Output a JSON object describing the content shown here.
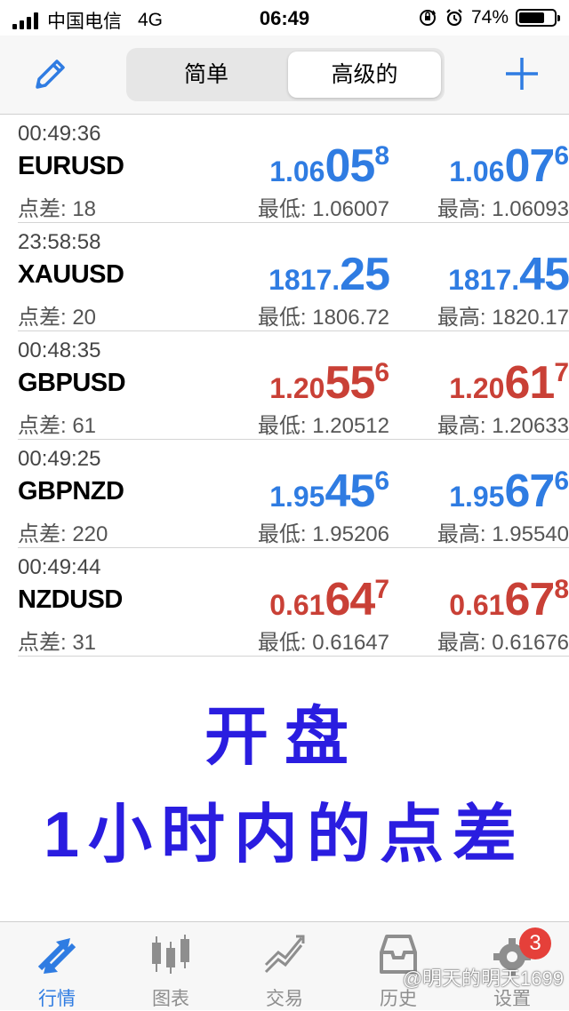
{
  "status_bar": {
    "carrier": "中国电信",
    "network": "4G",
    "time": "06:49",
    "battery": "74%",
    "battery_level": 0.74
  },
  "nav": {
    "segments": [
      "简单",
      "高级的"
    ],
    "selected_segment": 1,
    "edit_icon": "pencil-icon",
    "add_icon": "plus-icon"
  },
  "colors": {
    "up": "#2f7ce2",
    "down": "#c94036",
    "annotation": "#2a1de0"
  },
  "quotes": [
    {
      "time": "00:49:36",
      "symbol": "EURUSD",
      "spread": "点差: 18",
      "bid": {
        "pre": "1.06",
        "big": "05",
        "sup": "8"
      },
      "ask": {
        "pre": "1.06",
        "big": "07",
        "sup": "6"
      },
      "low": "最低: 1.06007",
      "high": "最高: 1.06093",
      "color": "blue"
    },
    {
      "time": "23:58:58",
      "symbol": "XAUUSD",
      "spread": "点差: 20",
      "bid": {
        "pre": "1817.",
        "big": "25",
        "sup": ""
      },
      "ask": {
        "pre": "1817.",
        "big": "45",
        "sup": ""
      },
      "low": "最低: 1806.72",
      "high": "最高: 1820.17",
      "color": "blue"
    },
    {
      "time": "00:48:35",
      "symbol": "GBPUSD",
      "spread": "点差: 61",
      "bid": {
        "pre": "1.20",
        "big": "55",
        "sup": "6"
      },
      "ask": {
        "pre": "1.20",
        "big": "61",
        "sup": "7"
      },
      "low": "最低: 1.20512",
      "high": "最高: 1.20633",
      "color": "red"
    },
    {
      "time": "00:49:25",
      "symbol": "GBPNZD",
      "spread": "点差: 220",
      "bid": {
        "pre": "1.95",
        "big": "45",
        "sup": "6"
      },
      "ask": {
        "pre": "1.95",
        "big": "67",
        "sup": "6"
      },
      "low": "最低: 1.95206",
      "high": "最高: 1.95540",
      "color": "blue"
    },
    {
      "time": "00:49:44",
      "symbol": "NZDUSD",
      "spread": "点差: 31",
      "bid": {
        "pre": "0.61",
        "big": "64",
        "sup": "7"
      },
      "ask": {
        "pre": "0.61",
        "big": "67",
        "sup": "8"
      },
      "low": "最低: 0.61647",
      "high": "最高: 0.61676",
      "color": "red"
    }
  ],
  "annotation": {
    "line1": "开盘",
    "line2": "1小时内的点差"
  },
  "tabs": [
    {
      "label": "行情",
      "icon": "quotes-arrows-icon",
      "active": true
    },
    {
      "label": "图表",
      "icon": "candlestick-chart-icon",
      "active": false
    },
    {
      "label": "交易",
      "icon": "trade-chart-icon",
      "active": false
    },
    {
      "label": "历史",
      "icon": "history-folder-icon",
      "active": false
    },
    {
      "label": "设置",
      "icon": "gear-icon",
      "active": false,
      "badge": "3"
    }
  ],
  "watermark": "@明天的明天1699"
}
